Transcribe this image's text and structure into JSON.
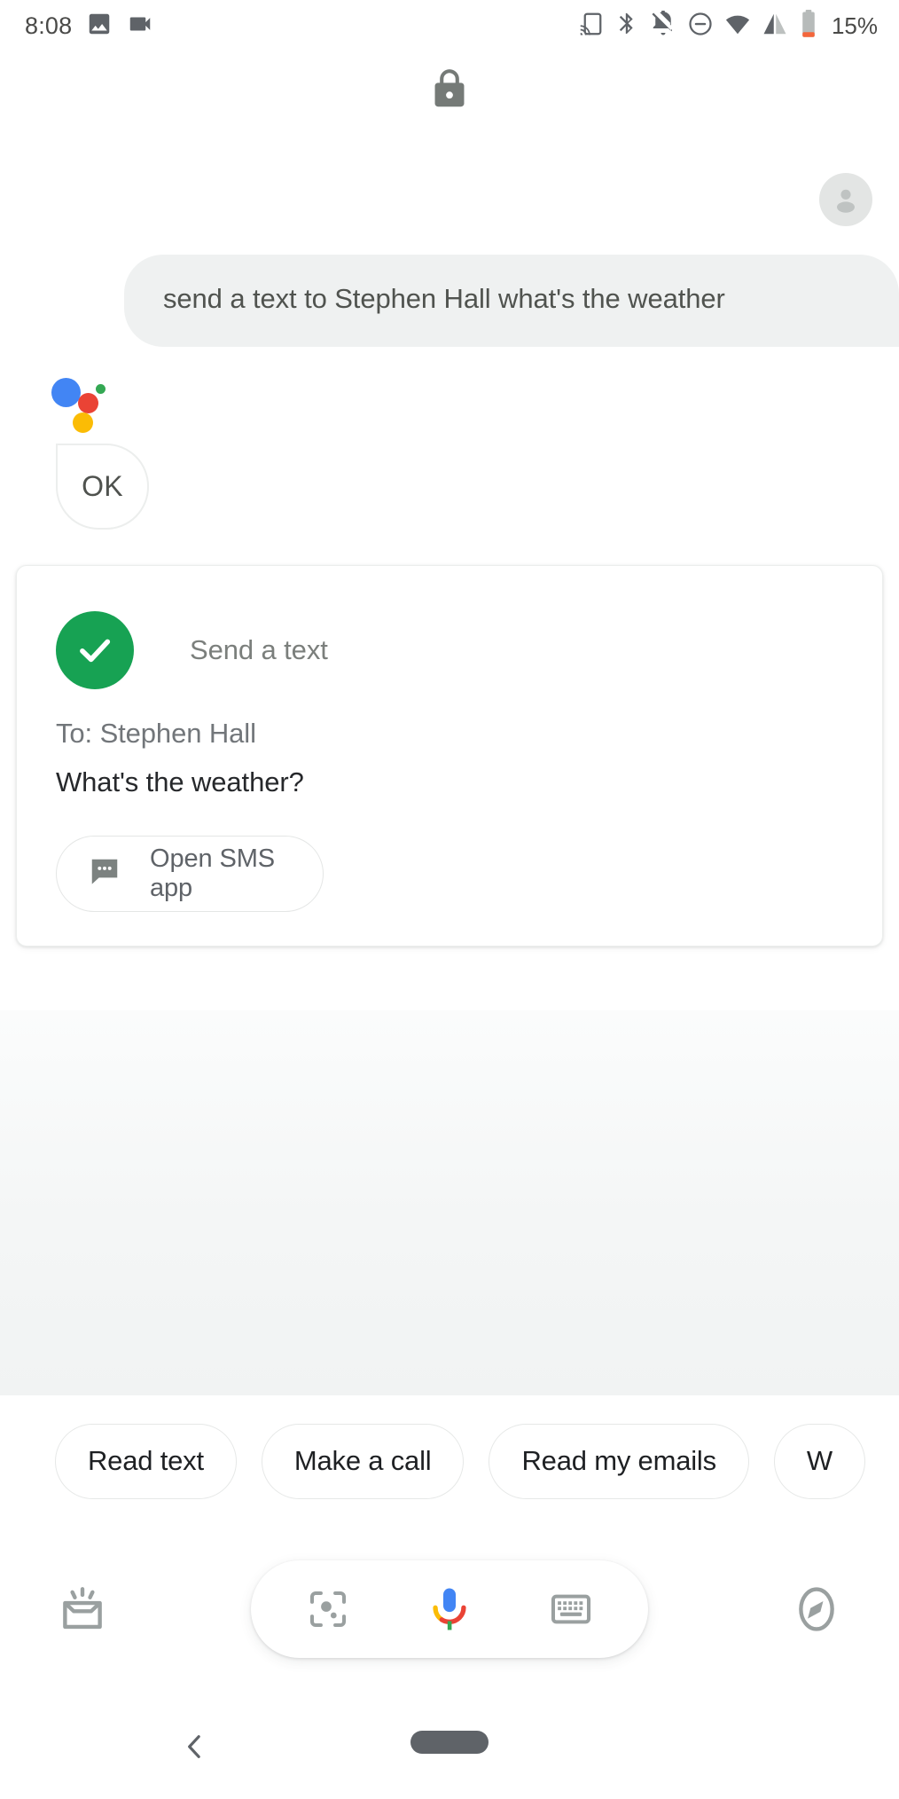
{
  "status_bar": {
    "time": "8:08",
    "battery_percent": "15%",
    "left_icons": [
      "photo-icon",
      "video-camera-icon"
    ],
    "right_icons": [
      "cast-icon",
      "bluetooth-icon",
      "notifications-muted-icon",
      "do-not-disturb-icon",
      "wifi-icon",
      "cellular-signal-icon",
      "battery-icon"
    ]
  },
  "lock": {
    "icon": "lock-icon",
    "color": "#757a77"
  },
  "conversation": {
    "user": {
      "avatar": "user-avatar-icon",
      "query": "send a text to Stephen Hall what's the weather"
    },
    "assistant": {
      "logo": "google-assistant-logo",
      "logo_colors": {
        "blue": "#4285f4",
        "red": "#ea4335",
        "yellow": "#fbbc05",
        "green": "#34a853"
      },
      "reply": "OK"
    }
  },
  "result_card": {
    "status_icon": "check-circle-icon",
    "status_color": "#17a253",
    "title": "Send a text",
    "recipient": "To: Stephen Hall",
    "message": "What's the weather?",
    "action_button": {
      "icon": "chat-bubble-icon",
      "label": "Open SMS app"
    }
  },
  "suggestions": [
    {
      "label": "Read text"
    },
    {
      "label": "Make a call"
    },
    {
      "label": "Read my emails"
    },
    {
      "label": "W"
    }
  ],
  "bottom_bar": {
    "snapshot": "snapshot-icon",
    "lens": "google-lens-icon",
    "mic": "google-mic-icon",
    "keyboard": "keyboard-icon",
    "explore": "explore-compass-icon"
  },
  "nav_bar": {
    "back": "back-chevron-icon",
    "home": "home-pill-icon"
  }
}
